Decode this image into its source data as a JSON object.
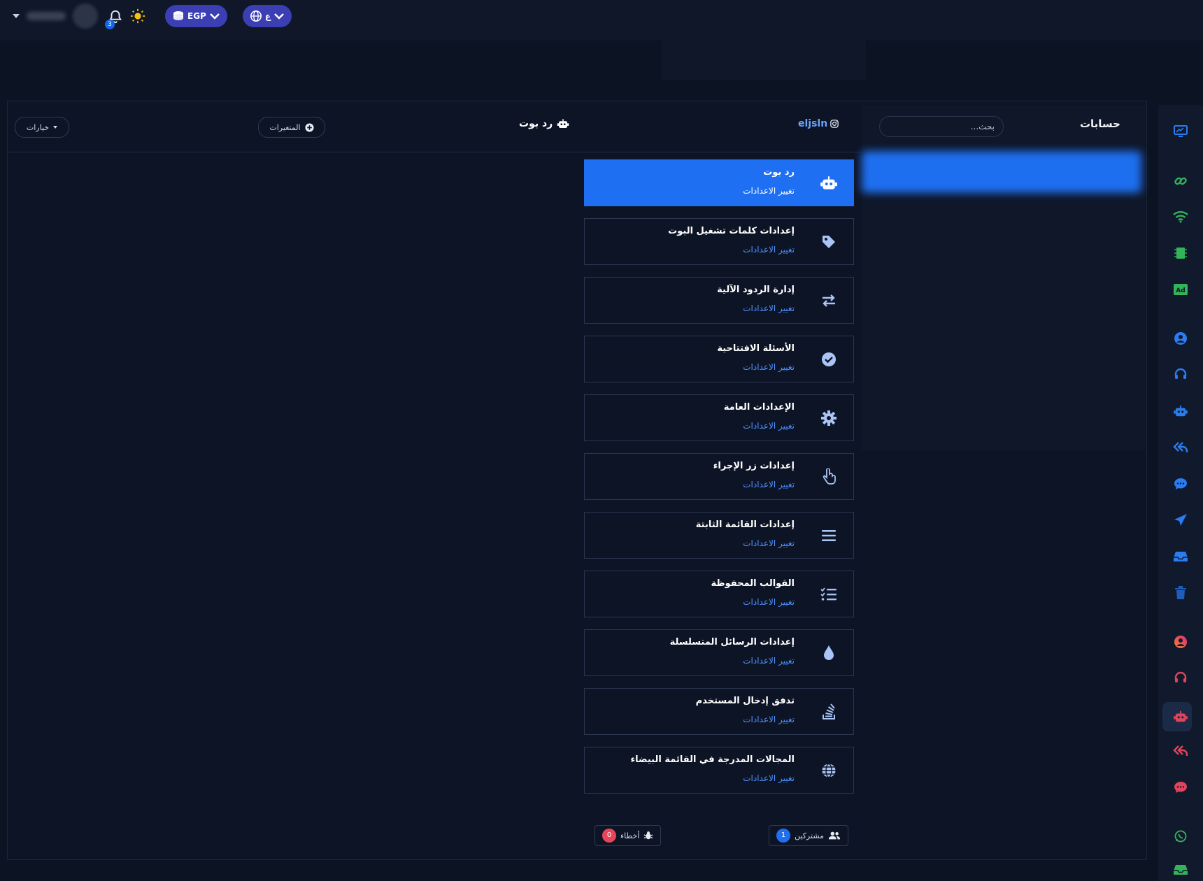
{
  "topbar": {
    "notifications_count": "3",
    "currency_label": "EGP",
    "language_label": "ع"
  },
  "accounts": {
    "title": "حسابات",
    "search_placeholder": "بحث..."
  },
  "header": {
    "options_label": "خيارات",
    "variables_label": "المتغيرات",
    "bot_title": "رد بوت",
    "account_name": "eljsln"
  },
  "settings": [
    {
      "title": "رد بوت",
      "subtitle": "تغيير الاعدادات",
      "icon": "robot-icon",
      "active": true
    },
    {
      "title": "إعدادات كلمات تشغيل البوت",
      "subtitle": "تغيير الاعدادات",
      "icon": "tag-icon"
    },
    {
      "title": "إدارة الردود الآلية",
      "subtitle": "تغيير الاعدادات",
      "icon": "exchange-icon"
    },
    {
      "title": "الأسئلة الافتتاحية",
      "subtitle": "تغيير الاعدادات",
      "icon": "check-circle-icon"
    },
    {
      "title": "الإعدادات العامة",
      "subtitle": "تغيير الاعدادات",
      "icon": "gear-icon"
    },
    {
      "title": "إعدادات زر الإجراء",
      "subtitle": "تغيير الاعدادات",
      "icon": "pointer-hand-icon"
    },
    {
      "title": "إعدادات القائمة الثابتة",
      "subtitle": "تغيير الاعدادات",
      "icon": "menu-bars-icon"
    },
    {
      "title": "القوالب المحفوظة",
      "subtitle": "تغيير الاعدادات",
      "icon": "checklist-icon"
    },
    {
      "title": "إعدادات الرسائل المتسلسلة",
      "subtitle": "تغيير الاعدادات",
      "icon": "droplet-icon"
    },
    {
      "title": "تدفق إدخال المستخدم",
      "subtitle": "تغيير الاعدادات",
      "icon": "stack-flow-icon"
    },
    {
      "title": "المجالات المدرجة في القائمة البيضاء",
      "subtitle": "تغيير الاعدادات",
      "icon": "globe-icon"
    }
  ],
  "footer": {
    "subscribers_label": "مشتركين",
    "subscribers_count": "1",
    "errors_label": "أخطاء",
    "errors_count": "0"
  },
  "colors": {
    "background": "#0c1322",
    "accent": "#1f6ff2",
    "link": "#4f93ff",
    "pill": "#3b3fb3",
    "error": "#e8455a"
  }
}
